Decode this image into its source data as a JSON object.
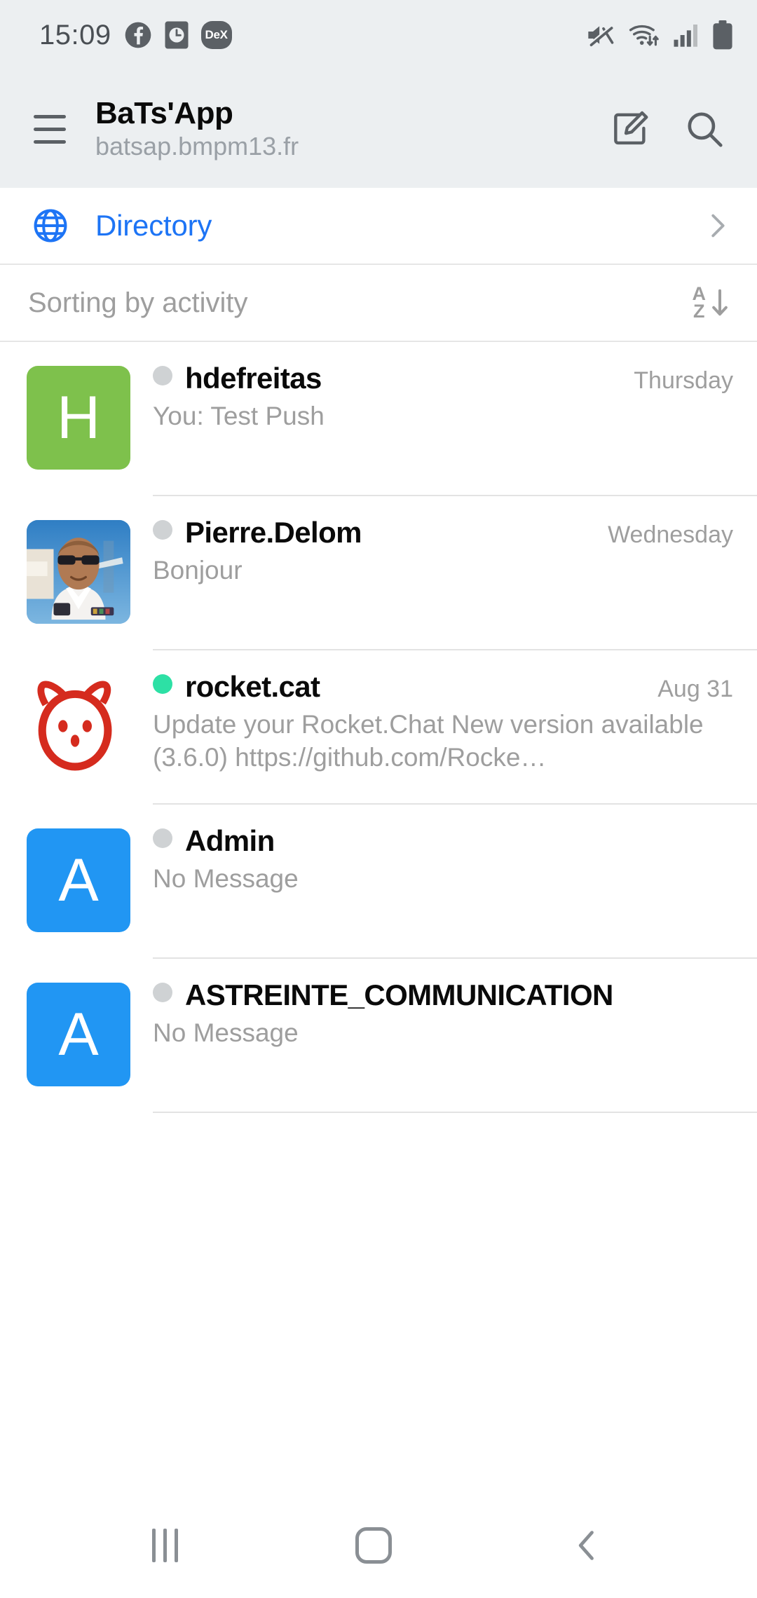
{
  "status_bar": {
    "time": "15:09",
    "left_icons": [
      "facebook-icon",
      "clock-icon",
      "dex-badge"
    ],
    "dex_label": "DeX",
    "right_icons": [
      "mute-icon",
      "wifi-icon",
      "cellular-signal-icon",
      "battery-icon"
    ],
    "background": "#eceff1",
    "icon_color": "#5b6065"
  },
  "app_bar": {
    "menu_icon": "hamburger-menu-icon",
    "title": "BaTs'App",
    "subtitle": "batsap.bmpm13.fr",
    "actions": [
      "compose-icon",
      "search-icon"
    ]
  },
  "directory": {
    "icon": "globe-icon",
    "label": "Directory",
    "chevron": "chevron-right-icon",
    "accent_color": "#1d74f5"
  },
  "sorting": {
    "label": "Sorting by activity",
    "icon": "sort-az-descending-icon",
    "icon_letters": [
      "A",
      "Z"
    ]
  },
  "chats": [
    {
      "avatar_type": "initial",
      "avatar_letter": "H",
      "avatar_color": "#7ec14c",
      "status": "offline",
      "status_color": "#cfd2d4",
      "name": "hdefreitas",
      "message": "You: Test Push",
      "time": "Thursday"
    },
    {
      "avatar_type": "photo",
      "avatar_letter": "",
      "avatar_color": "#6ba8d8",
      "status": "offline",
      "status_color": "#cfd2d4",
      "name": "Pierre.Delom",
      "message": "Bonjour",
      "time": "Wednesday"
    },
    {
      "avatar_type": "rocketcat",
      "avatar_letter": "",
      "avatar_color": "#d52b1e",
      "status": "online",
      "status_color": "#2de0a5",
      "name": "rocket.cat",
      "message": "Update your Rocket.Chat New version available (3.6.0) https://github.com/Rocke…",
      "time": "Aug 31"
    },
    {
      "avatar_type": "initial",
      "avatar_letter": "A",
      "avatar_color": "#2196f3",
      "status": "offline",
      "status_color": "#cfd2d4",
      "name": "Admin",
      "message": "No Message",
      "time": ""
    },
    {
      "avatar_type": "initial",
      "avatar_letter": "A",
      "avatar_color": "#2196f3",
      "status": "offline",
      "status_color": "#cfd2d4",
      "name": "ASTREINTE_COMMUNICATION",
      "message": "No Message",
      "time": ""
    }
  ],
  "nav_bar": {
    "recents_icon": "recents-icon",
    "home_icon": "home-icon",
    "back_icon": "back-icon",
    "icon_color": "#8a8f94"
  }
}
